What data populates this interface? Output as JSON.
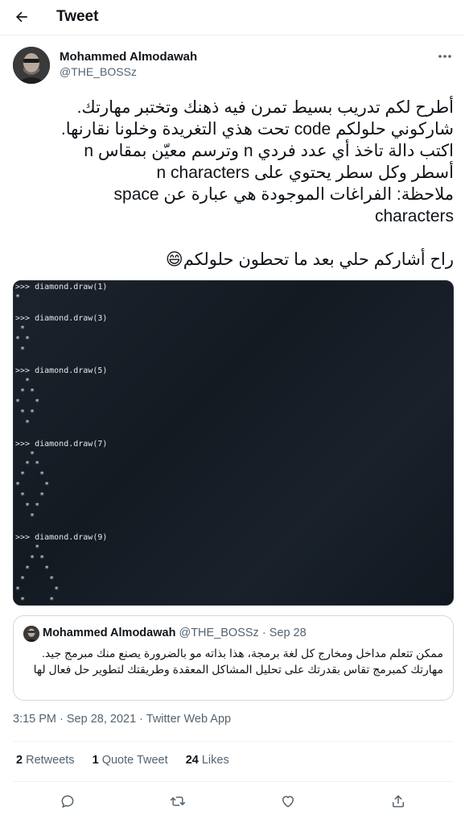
{
  "header": {
    "title": "Tweet"
  },
  "tweet": {
    "author_name": "Mohammed Almodawah",
    "author_handle": "@THE_BOSSz",
    "text_lines": [
      "أطرح لكم تدريب بسيط تمرن فيه ذهنك وتختبر مهارتك.",
      "شاركوني حلولكم code تحت هذي التغريدة وخلونا نقارنها.",
      "اكتب دالة تاخذ أي عدد فردي n وترسم معيّن بمقاس n",
      "أسطر وكل سطر يحتوي على n characters",
      "ملاحظة: الفراغات الموجودة هي عبارة عن space",
      "characters",
      "",
      "راح أشاركم حلي بعد ما تحطون حلولكم😄"
    ],
    "code_lines": [
      ">>> diamond.draw(1)",
      "*",
      "",
      ">>> diamond.draw(3)",
      " *",
      "* *",
      " *",
      "",
      ">>> diamond.draw(5)",
      "  *",
      " * *",
      "*   *",
      " * *",
      "  *",
      "",
      ">>> diamond.draw(7)",
      "   *",
      "  * *",
      " *   *",
      "*     *",
      " *   *",
      "  * *",
      "   *",
      "",
      ">>> diamond.draw(9)",
      "    *",
      "   * *",
      "  *   *",
      " *     *",
      "*       *",
      " *     *",
      "  *   *",
      "   * *",
      "    *",
      ">>>"
    ],
    "timestamp": "3:15 PM · Sep 28, 2021 · Twitter Web App"
  },
  "quote": {
    "author_name": "Mohammed Almodawah",
    "author_handle": "@THE_BOSSz",
    "separator": "·",
    "date": "Sep 28",
    "text": "ممكن تتعلم مداخل ومخارج كل لغة برمجة، هذا بذاته مو بالضرورة يصنع منك مبرمج جيد. مهارتك كمبرمج تقاس بقدرتك على تحليل المشاكل المعقدة وطريقتك لتطوير حل فعال لها"
  },
  "stats": [
    {
      "count": "2",
      "label": "Retweets"
    },
    {
      "count": "1",
      "label": "Quote Tweet"
    },
    {
      "count": "24",
      "label": "Likes"
    }
  ],
  "actions": [
    {
      "icon": "reply-icon"
    },
    {
      "icon": "retweet-icon"
    },
    {
      "icon": "like-icon"
    },
    {
      "icon": "share-icon"
    }
  ],
  "colors": {
    "text": "#0f1419",
    "secondary": "#536471",
    "border": "#cfd9de",
    "divider": "#eff3f4",
    "code_bg": "#13181f"
  }
}
